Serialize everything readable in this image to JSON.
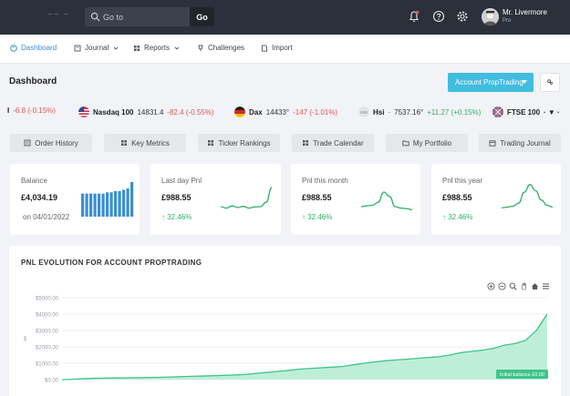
{
  "search": {
    "placeholder": "Go to",
    "button": "Go"
  },
  "user": {
    "name": "Mr. Livermore",
    "role": "Pro"
  },
  "nav": [
    {
      "label": "Dashboard",
      "icon": "palette-icon",
      "active": true
    },
    {
      "label": "Journal",
      "icon": "book-icon",
      "dropdown": true
    },
    {
      "label": "Reports",
      "icon": "grid-icon",
      "dropdown": true
    },
    {
      "label": "Challenges",
      "icon": "trophy-icon"
    },
    {
      "label": "Import",
      "icon": "file-icon"
    }
  ],
  "page": {
    "title": "Dashboard",
    "account_button": "Account PropTrading"
  },
  "ticker": [
    {
      "name": "",
      "price": "",
      "change": "-6.8 (-0.15%)",
      "dir": "neg"
    },
    {
      "name": "Nasdaq 100",
      "price": "14831.4",
      "change": "-82.4 (-0.55%)",
      "dir": "neg",
      "flag": "us-flag-icon"
    },
    {
      "name": "Dax",
      "price": "14433°",
      "change": "-147 (-1.01%)",
      "dir": "neg",
      "flag": "de-flag-icon"
    },
    {
      "name": "Hsi",
      "price": "7537.16°",
      "change": "+11.27 (+0.15%)",
      "dir": "pos",
      "flag": "hk-flag-icon",
      "flag_text": "HSI"
    },
    {
      "name": "FTSE 100",
      "price": "",
      "change": "",
      "dir": "pos",
      "flag": "uk-flag-icon"
    }
  ],
  "quick_buttons": [
    {
      "label": "Order History",
      "icon": "list-icon"
    },
    {
      "label": "Key Metrics",
      "icon": "grid-icon"
    },
    {
      "label": "Ticker Rankings",
      "icon": "grid-icon"
    },
    {
      "label": "Trade Calendar",
      "icon": "grid-icon"
    },
    {
      "label": "My Portfolio",
      "icon": "folder-icon"
    },
    {
      "label": "Trading Journal",
      "icon": "calendar-icon"
    }
  ],
  "cards": [
    {
      "title": "Balance",
      "value": "£4,034.19",
      "sub": "on 04/01/2022",
      "bars": [
        18,
        18,
        18,
        18,
        18,
        18,
        19,
        19,
        20,
        20,
        21,
        22,
        27
      ]
    },
    {
      "title": "Last day Pnl",
      "value": "£988.55",
      "pct": "32.46%",
      "spark": [
        0.75,
        0.8,
        0.72,
        0.78,
        0.74,
        0.8,
        0.76,
        0.75,
        0.6,
        0.1
      ]
    },
    {
      "title": "Pnl this month",
      "value": "£988.55",
      "pct": "32.46%",
      "spark": [
        0.75,
        0.72,
        0.7,
        0.6,
        0.25,
        0.4,
        0.75,
        0.8,
        0.82,
        0.85
      ]
    },
    {
      "title": "Pnl this year",
      "value": "£988.55",
      "pct": "32.46%",
      "spark": [
        0.8,
        0.78,
        0.75,
        0.65,
        0.3,
        0.05,
        0.25,
        0.55,
        0.72,
        0.78
      ]
    }
  ],
  "chart_data": {
    "type": "area",
    "title": "PNL EVOLUTION  FOR ACCOUNT PROPTRADING",
    "ylabel": "$",
    "ylim": [
      0,
      5000
    ],
    "yticks": [
      "$0.00",
      "$1000.00",
      "$2000.00",
      "$3000.00",
      "$4000.00",
      "$5000.00"
    ],
    "values": [
      0,
      20,
      60,
      80,
      90,
      100,
      110,
      120,
      130,
      140,
      160,
      180,
      200,
      220,
      240,
      260,
      280,
      320,
      380,
      440,
      500,
      560,
      640,
      680,
      720,
      760,
      800,
      900,
      1000,
      1080,
      1150,
      1200,
      1250,
      1300,
      1350,
      1400,
      1500,
      1650,
      1720,
      1800,
      1900,
      2100,
      2200,
      2400,
      3000,
      4000
    ],
    "annotation": "Initial balance £0.00",
    "color": "#3ec48a"
  },
  "colors": {
    "accent": "#41bde0",
    "positive": "#2fae6a",
    "negative": "#e05555",
    "bar": "#3a8fd0"
  }
}
